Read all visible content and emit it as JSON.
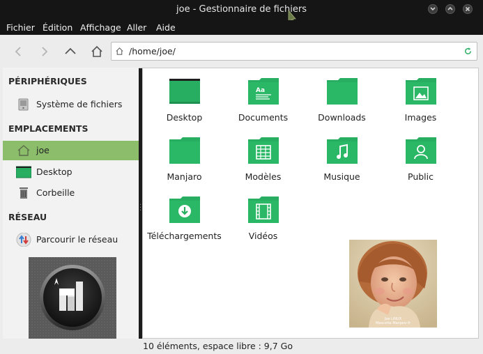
{
  "window": {
    "title": "joe - Gestionnaire de fichiers"
  },
  "menu": [
    "Fichier",
    "Édition",
    "Affichage",
    "Aller",
    "Aide"
  ],
  "toolbar": {
    "path": "/home/joe/"
  },
  "sidebar": {
    "sections": [
      {
        "title": "PÉRIPHÉRIQUES",
        "items": [
          {
            "label": "Système de fichiers",
            "icon": "drive-icon"
          }
        ]
      },
      {
        "title": "EMPLACEMENTS",
        "items": [
          {
            "label": "joe",
            "icon": "home-icon",
            "active": true
          },
          {
            "label": "Desktop",
            "icon": "desktop-icon"
          },
          {
            "label": "Corbeille",
            "icon": "trash-icon"
          }
        ]
      },
      {
        "title": "RÉSEAU",
        "items": [
          {
            "label": "Parcourir le réseau",
            "icon": "network-icon"
          }
        ]
      }
    ]
  },
  "files": [
    {
      "name": "Desktop",
      "icon": "desktop-folder-icon"
    },
    {
      "name": "Documents",
      "icon": "documents-folder-icon"
    },
    {
      "name": "Downloads",
      "icon": "folder-icon"
    },
    {
      "name": "Images",
      "icon": "images-folder-icon"
    },
    {
      "name": "Manjaro",
      "icon": "folder-icon"
    },
    {
      "name": "Modèles",
      "icon": "templates-folder-icon"
    },
    {
      "name": "Musique",
      "icon": "music-folder-icon"
    },
    {
      "name": "Public",
      "icon": "public-folder-icon"
    },
    {
      "name": "Téléchargements",
      "icon": "download-folder-icon"
    },
    {
      "name": "Vidéos",
      "icon": "videos-folder-icon"
    }
  ],
  "photo_caption": [
    "Joe LINUX",
    "Mascotte Manjaro-fr"
  ],
  "status": "10 éléments, espace libre : 9,7 Go",
  "colors": {
    "folder": "#27ae60",
    "folder_dark": "#1e9150",
    "active": "#8bbd6a",
    "titlebar": "#151515"
  }
}
